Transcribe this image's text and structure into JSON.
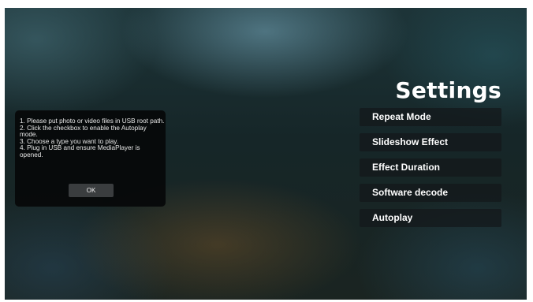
{
  "settings": {
    "title": "Settings",
    "menu": [
      {
        "label": "Repeat Mode"
      },
      {
        "label": "Slideshow Effect"
      },
      {
        "label": "Effect Duration"
      },
      {
        "label": "Software decode"
      },
      {
        "label": "Autoplay"
      }
    ]
  },
  "dialog": {
    "lines": [
      "1. Please put photo or video files in USB root path.",
      "2. Click the checkbox to enable the Autoplay mode.",
      "3. Choose a type you want to play.",
      "4. Plug in USB and ensure MediaPlayer is opened."
    ],
    "ok_label": "OK"
  }
}
